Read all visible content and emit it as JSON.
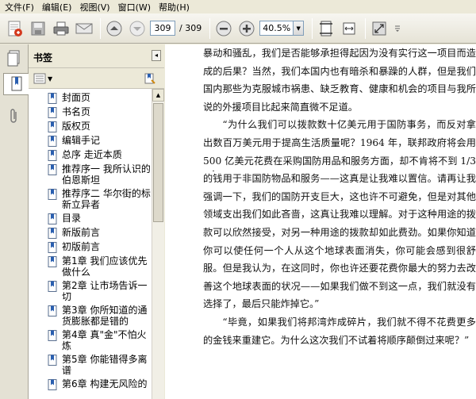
{
  "menu": [
    "文件(F)",
    "编辑(E)",
    "视图(V)",
    "窗口(W)",
    "帮助(H)"
  ],
  "toolbar": {
    "page_current": "309",
    "page_total": "/ 309",
    "zoom": "40.5%",
    "icons": [
      "create-pdf-icon",
      "save-icon",
      "print-icon",
      "email-icon",
      "prev-page-icon",
      "next-page-icon",
      "zoom-out-icon",
      "zoom-in-icon",
      "fit-page-icon",
      "fit-width-icon",
      "fullscreen-icon"
    ]
  },
  "panel": {
    "title": "书签",
    "close_glyph": "◂",
    "bookmarks": [
      "封面页",
      "书名页",
      "版权页",
      "编辑手记",
      "总序 走近本质",
      "推荐序一 我所认识的伯恩斯坦",
      "推荐序二 华尔街的标新立异者",
      "目录",
      "新版前言",
      "初版前言",
      "第1章 我们应该优先做什么",
      "第2章 让市场告诉一切",
      "第3章 你所知道的通货膨胀都是错的",
      "第4章 真\"金\"不怕火炼",
      "第5章 你能错得多离谱",
      "第6章 构建无风险的"
    ]
  },
  "document": {
    "paragraphs": [
      {
        "indent": false,
        "text": "暴动和骚乱，我们是否能够承担得起因为没有实行这一项目而造成的后果？当然，我们本国内也有暗杀和暴躁的人群，但是我们国内那些为克服城市祸患、缺乏教育、健康和机会的项目与我所说的外援项目比起来简直微不足道。"
      },
      {
        "indent": true,
        "text": "“为什么我们可以拨款数十亿美元用于国防事务，而反对拿出数百万美元用于提高生活质量呢？1964 年，联邦政府将会用 500 亿美元花费在采购国防用品和服务方面，却不肯将不到 1/3 的钱用于非国防物品和服务——这真是让我难以置信。请再让我强调一下，我们的国防开支巨大，这也许不可避免，但是对其他领域支出我们如此吝啬，这真让我难以理解。对于这种用途的拨款可以欣然接受，对另一种用途的拨款却如此费劲。如果你知道你可以使任何一个人从这个地球表面消失，你可能会感到很舒服。但是我认为，在这同时，你也许还要花费你最大的努力去改善这个地球表面的状况——如果我们做不到这一点，我们就没有选择了，最后只能炸掉它。”"
      },
      {
        "indent": true,
        "text": "“毕竟，如果我们将邦湾炸成碎片，我们就不得不花费更多的金钱来重建它。为什么这次我们不试着将顺序颠倒过来呢？”"
      }
    ]
  }
}
